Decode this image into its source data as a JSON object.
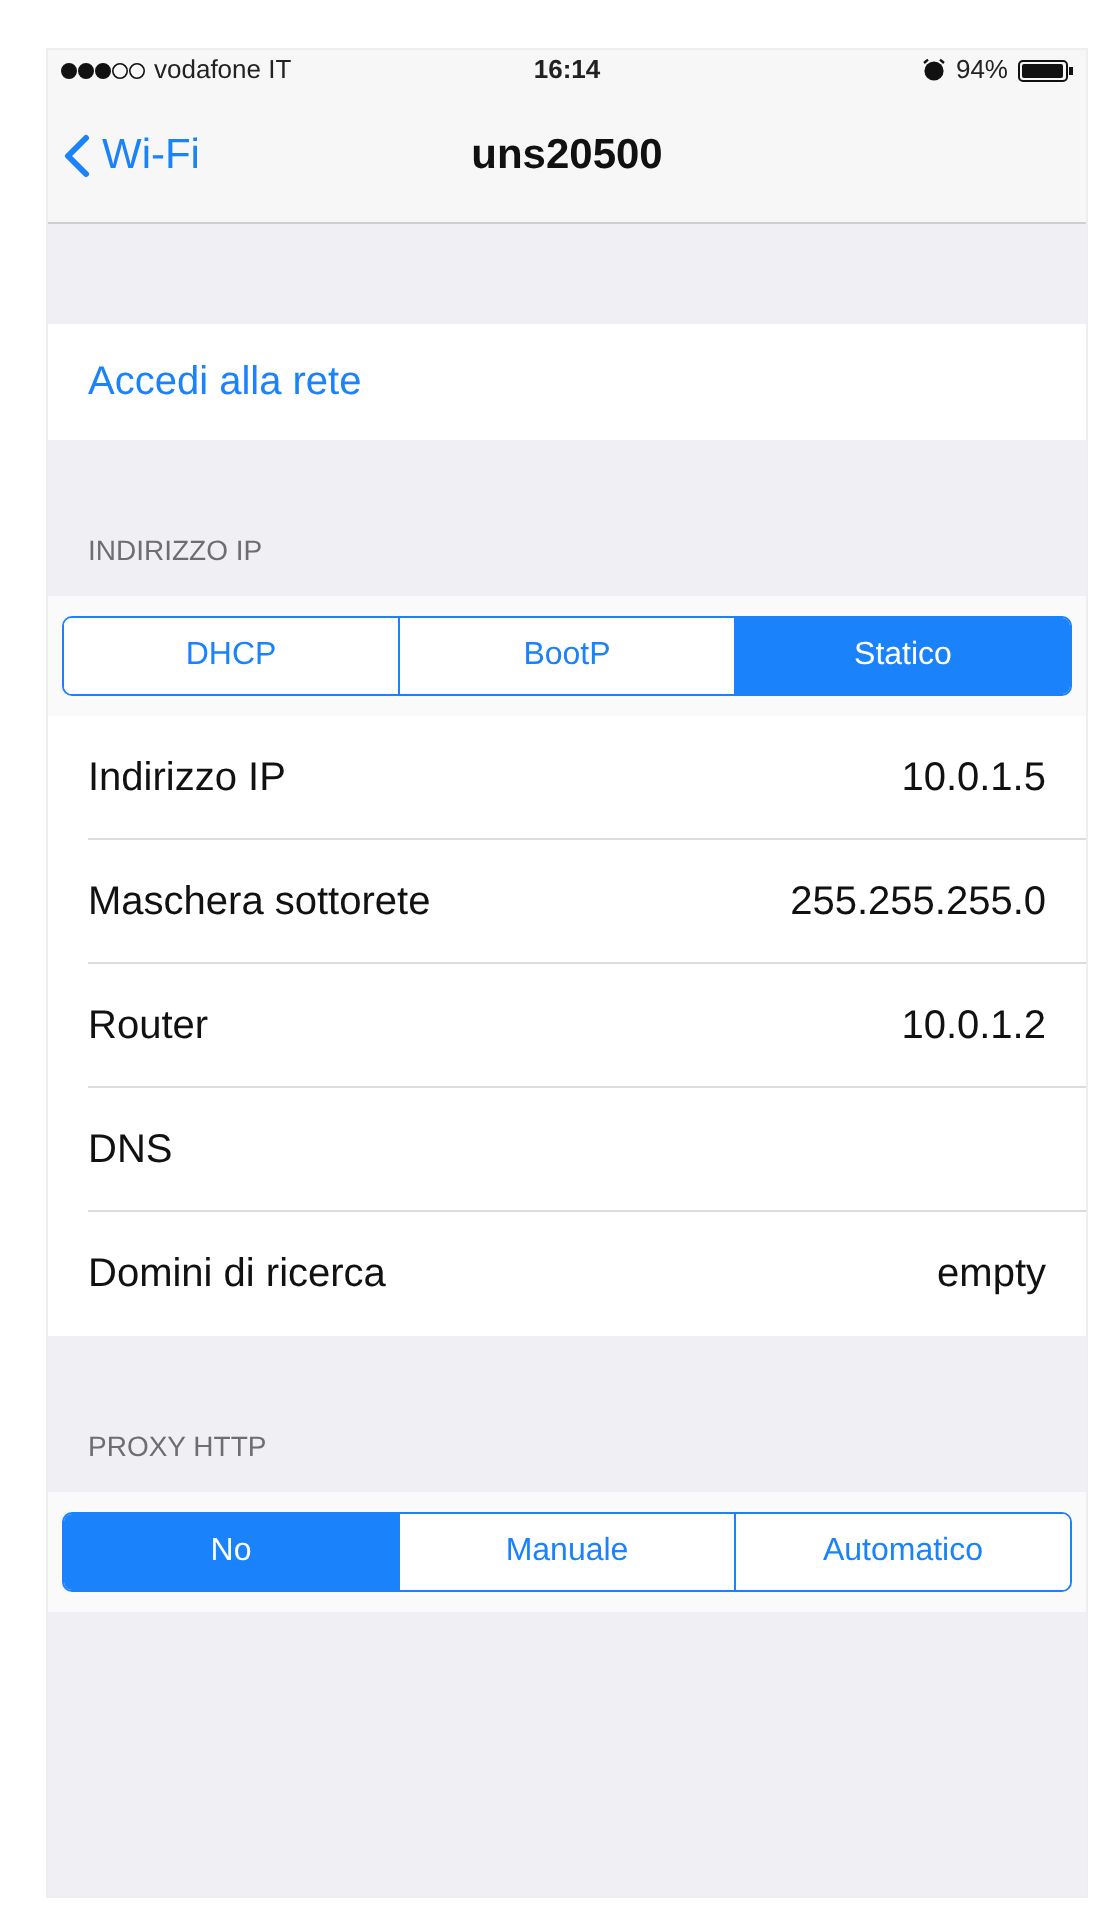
{
  "status_bar": {
    "carrier": "vodafone IT",
    "time": "16:14",
    "battery": "94%"
  },
  "nav": {
    "back": "Wi-Fi",
    "title": "uns20500"
  },
  "join_link": "Accedi alla rete",
  "ip_section": {
    "header": "INDIRIZZO IP",
    "modes": [
      {
        "label": "DHCP",
        "selected": false
      },
      {
        "label": "BootP",
        "selected": false
      },
      {
        "label": "Statico",
        "selected": true
      }
    ],
    "rows": [
      {
        "label": "Indirizzo IP",
        "value": "10.0.1.5"
      },
      {
        "label": "Maschera sottorete",
        "value": "255.255.255.0"
      },
      {
        "label": "Router",
        "value": "10.0.1.2"
      },
      {
        "label": "DNS"
      },
      {
        "label": "Domini di ricerca",
        "value": "empty"
      }
    ]
  },
  "proxy_section": {
    "header": "PROXY HTTP",
    "modes": [
      {
        "label": "No",
        "selected": true
      },
      {
        "label": "Manuale",
        "selected": false
      },
      {
        "label": "Automatico",
        "selected": false
      }
    ]
  }
}
